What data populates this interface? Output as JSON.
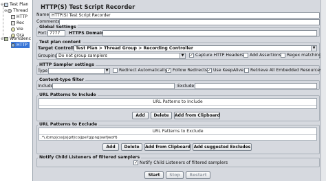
{
  "tree": {
    "items": [
      {
        "label": "Test Plan",
        "toggle": "⊖"
      },
      {
        "label": "Thread",
        "toggle": "⊖"
      },
      {
        "label": "HTTP",
        "toggle": ""
      },
      {
        "label": "Rec",
        "toggle": ""
      },
      {
        "label": "Vie",
        "toggle": ""
      },
      {
        "label": "Gra",
        "toggle": ""
      },
      {
        "label": "WorkBenc",
        "toggle": "⊖"
      },
      {
        "label": "HTTP",
        "toggle": ""
      }
    ]
  },
  "header": {
    "title": "HTTP(S) Test Script Recorder"
  },
  "fields": {
    "name_label": "Name:",
    "name_value": "HTTP(S) Test Script Recorder",
    "comments_label": "Comments:"
  },
  "global": {
    "title": "Global Settings",
    "port_label": "Port:",
    "port_value": "7777",
    "https_label": "HTTPS Domains :"
  },
  "content": {
    "title": "Test plan content",
    "target_label": "Target Controller:",
    "target_value": "Test Plan > Thread Group > Recording Controller",
    "grouping_label": "Grouping:",
    "grouping_value": "Do not group samplers",
    "capture_headers": "Capture HTTP Headers",
    "add_assertions": "Add Assertions",
    "regex_matching": "Regex matching"
  },
  "sampler": {
    "title": "HTTP Sampler settings",
    "type_label": "Type:",
    "redirect_auto": "Redirect Automatically",
    "follow_redirects": "Follow Redirects",
    "keepalive": "Use KeepAlive",
    "retrieve_embedded": "Retrieve All Embedded Resources"
  },
  "filter": {
    "title": "Content-type filter",
    "include_label": "Include:",
    "exclude_label": "Exclude:"
  },
  "include_patterns": {
    "title": "URL Patterns to Include",
    "header": "URL Patterns to Include",
    "rows": [],
    "add": "Add",
    "delete": "Delete",
    "add_clipboard": "Add from Clipboard"
  },
  "exclude_patterns": {
    "title": "URL Patterns to Exclude",
    "header": "URL Patterns to Exclude",
    "rows": [
      ".*\\.(bmp|css|js|gif|ico|jpe?g|png|swf|woff)"
    ],
    "add": "Add",
    "delete": "Delete",
    "add_clipboard": "Add from Clipboard",
    "add_suggested": "Add suggested Excludes"
  },
  "notify": {
    "title": "Notify Child Listeners of filtered samplers",
    "checkbox": "Notify Child Listeners of filtered samplers"
  },
  "controls": {
    "start": "Start",
    "stop": "Stop",
    "restart": "Restart"
  }
}
